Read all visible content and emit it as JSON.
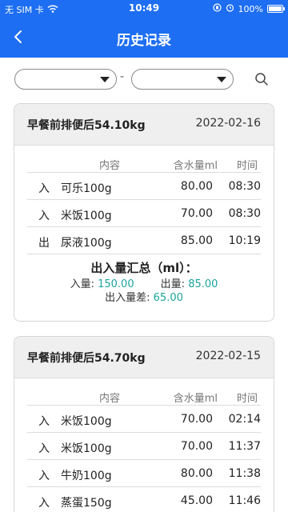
{
  "status_bar": {
    "carrier": "无 SIM 卡",
    "time": "10:49",
    "battery": "100%",
    "battery_level": 1.0
  },
  "nav": {
    "back_icon": "chevron-left-icon",
    "title": "历史记录"
  },
  "filter": {
    "separator": "-",
    "search_icon": "search-icon"
  },
  "table_headers": {
    "content": "内容",
    "water": "含水量ml",
    "time": "时间"
  },
  "records": [
    {
      "title": "早餐前排便后54.10kg",
      "date": "2022-02-16",
      "items": [
        {
          "type": "入",
          "name": "可乐100g",
          "water": "80.00",
          "time": "08:30"
        },
        {
          "type": "入",
          "name": "米饭100g",
          "water": "70.00",
          "time": "08:30"
        },
        {
          "type": "出",
          "name": "尿液100g",
          "water": "85.00",
          "time": "10:19"
        }
      ],
      "summary": {
        "title": "出入量汇总（ml）：",
        "in_label": "入量:",
        "in_value": "150.00",
        "out_label": "出量:",
        "out_value": "85.00",
        "diff_label": "出入量差:",
        "diff_value": "65.00"
      }
    },
    {
      "title": "早餐前排便后54.70kg",
      "date": "2022-02-15",
      "items": [
        {
          "type": "入",
          "name": "米饭100g",
          "water": "70.00",
          "time": "02:14"
        },
        {
          "type": "入",
          "name": "米饭100g",
          "water": "70.00",
          "time": "11:37"
        },
        {
          "type": "入",
          "name": "牛奶100g",
          "water": "80.00",
          "time": "11:38"
        },
        {
          "type": "入",
          "name": "蒸蛋150g",
          "water": "45.00",
          "time": "11:46"
        }
      ]
    }
  ],
  "colors": {
    "primary": "#1d6ef2",
    "accent": "#1ba39c"
  }
}
